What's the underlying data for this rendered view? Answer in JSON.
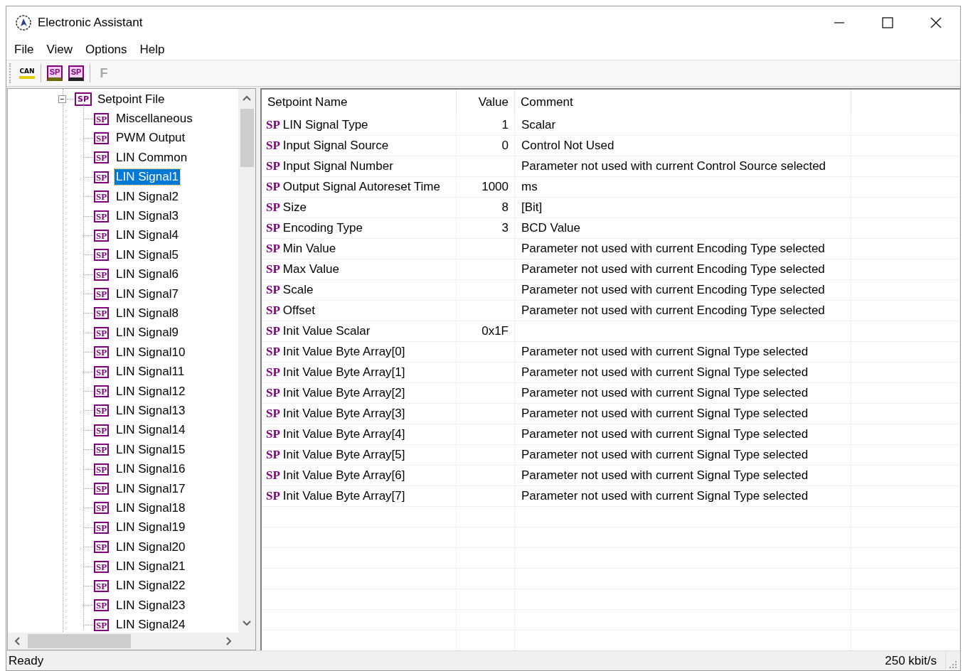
{
  "window": {
    "title": "Electronic Assistant"
  },
  "menu": [
    "File",
    "View",
    "Options",
    "Help"
  ],
  "toolbar": [
    {
      "kind": "can",
      "label": "CAN",
      "disabled": false
    },
    {
      "kind": "open",
      "label": "SP",
      "disabled": false
    },
    {
      "kind": "save",
      "label": "SP",
      "disabled": false
    },
    {
      "kind": "letter",
      "label": "F",
      "disabled": true
    }
  ],
  "tree": {
    "root": {
      "label": "Setpoint File",
      "icon": "SP",
      "expanded": true,
      "children": [
        {
          "label": "Miscellaneous",
          "icon": "SP",
          "selected": false
        },
        {
          "label": "PWM Output",
          "icon": "SP",
          "selected": false
        },
        {
          "label": "LIN Common",
          "icon": "SP",
          "selected": false
        },
        {
          "label": "LIN Signal1",
          "icon": "SP",
          "selected": true
        },
        {
          "label": "LIN Signal2",
          "icon": "SP",
          "selected": false
        },
        {
          "label": "LIN Signal3",
          "icon": "SP",
          "selected": false
        },
        {
          "label": "LIN Signal4",
          "icon": "SP",
          "selected": false
        },
        {
          "label": "LIN Signal5",
          "icon": "SP",
          "selected": false
        },
        {
          "label": "LIN Signal6",
          "icon": "SP",
          "selected": false
        },
        {
          "label": "LIN Signal7",
          "icon": "SP",
          "selected": false
        },
        {
          "label": "LIN Signal8",
          "icon": "SP",
          "selected": false
        },
        {
          "label": "LIN Signal9",
          "icon": "SP",
          "selected": false
        },
        {
          "label": "LIN Signal10",
          "icon": "SP",
          "selected": false
        },
        {
          "label": "LIN Signal11",
          "icon": "SP",
          "selected": false
        },
        {
          "label": "LIN Signal12",
          "icon": "SP",
          "selected": false
        },
        {
          "label": "LIN Signal13",
          "icon": "SP",
          "selected": false
        },
        {
          "label": "LIN Signal14",
          "icon": "SP",
          "selected": false
        },
        {
          "label": "LIN Signal15",
          "icon": "SP",
          "selected": false
        },
        {
          "label": "LIN Signal16",
          "icon": "SP",
          "selected": false
        },
        {
          "label": "LIN Signal17",
          "icon": "SP",
          "selected": false
        },
        {
          "label": "LIN Signal18",
          "icon": "SP",
          "selected": false
        },
        {
          "label": "LIN Signal19",
          "icon": "SP",
          "selected": false
        },
        {
          "label": "LIN Signal20",
          "icon": "SP",
          "selected": false
        },
        {
          "label": "LIN Signal21",
          "icon": "SP",
          "selected": false
        },
        {
          "label": "LIN Signal22",
          "icon": "SP",
          "selected": false
        },
        {
          "label": "LIN Signal23",
          "icon": "SP",
          "selected": false
        },
        {
          "label": "LIN Signal24",
          "icon": "SP",
          "selected": false
        }
      ]
    }
  },
  "table": {
    "columns": [
      "Setpoint Name",
      "Value",
      "Comment"
    ],
    "rows": [
      {
        "icon": "SP",
        "name": "LIN Signal Type",
        "value": "1",
        "comment": "Scalar"
      },
      {
        "icon": "SP",
        "name": "Input Signal Source",
        "value": "0",
        "comment": "Control Not Used"
      },
      {
        "icon": "SP",
        "name": "Input Signal Number",
        "value": "",
        "comment": "Parameter not used with current Control Source selected"
      },
      {
        "icon": "SP",
        "name": "Output Signal Autoreset Time",
        "value": "1000",
        "comment": "ms"
      },
      {
        "icon": "SP",
        "name": "Size",
        "value": "8",
        "comment": "[Bit]"
      },
      {
        "icon": "SP",
        "name": "Encoding Type",
        "value": "3",
        "comment": "BCD Value"
      },
      {
        "icon": "SP",
        "name": "Min Value",
        "value": "",
        "comment": "Parameter not used with current Encoding Type selected"
      },
      {
        "icon": "SP",
        "name": "Max Value",
        "value": "",
        "comment": "Parameter not used with current Encoding Type selected"
      },
      {
        "icon": "SP",
        "name": "Scale",
        "value": "",
        "comment": "Parameter not used with current Encoding Type selected"
      },
      {
        "icon": "SP",
        "name": "Offset",
        "value": "",
        "comment": "Parameter not used with current Encoding Type selected"
      },
      {
        "icon": "SP",
        "name": "Init Value Scalar",
        "value": "0x1F",
        "comment": ""
      },
      {
        "icon": "SP",
        "name": "Init Value Byte Array[0]",
        "value": "",
        "comment": "Parameter not used with current Signal Type selected"
      },
      {
        "icon": "SP",
        "name": "Init Value Byte Array[1]",
        "value": "",
        "comment": "Parameter not used with current Signal Type selected"
      },
      {
        "icon": "SP",
        "name": "Init Value Byte Array[2]",
        "value": "",
        "comment": "Parameter not used with current Signal Type selected"
      },
      {
        "icon": "SP",
        "name": "Init Value Byte Array[3]",
        "value": "",
        "comment": "Parameter not used with current Signal Type selected"
      },
      {
        "icon": "SP",
        "name": "Init Value Byte Array[4]",
        "value": "",
        "comment": "Parameter not used with current Signal Type selected"
      },
      {
        "icon": "SP",
        "name": "Init Value Byte Array[5]",
        "value": "",
        "comment": "Parameter not used with current Signal Type selected"
      },
      {
        "icon": "SP",
        "name": "Init Value Byte Array[6]",
        "value": "",
        "comment": "Parameter not used with current Signal Type selected"
      },
      {
        "icon": "SP",
        "name": "Init Value Byte Array[7]",
        "value": "",
        "comment": "Parameter not used with current Signal Type selected"
      }
    ]
  },
  "status_bar": {
    "message": "Ready",
    "baud": "250 kbit/s"
  }
}
